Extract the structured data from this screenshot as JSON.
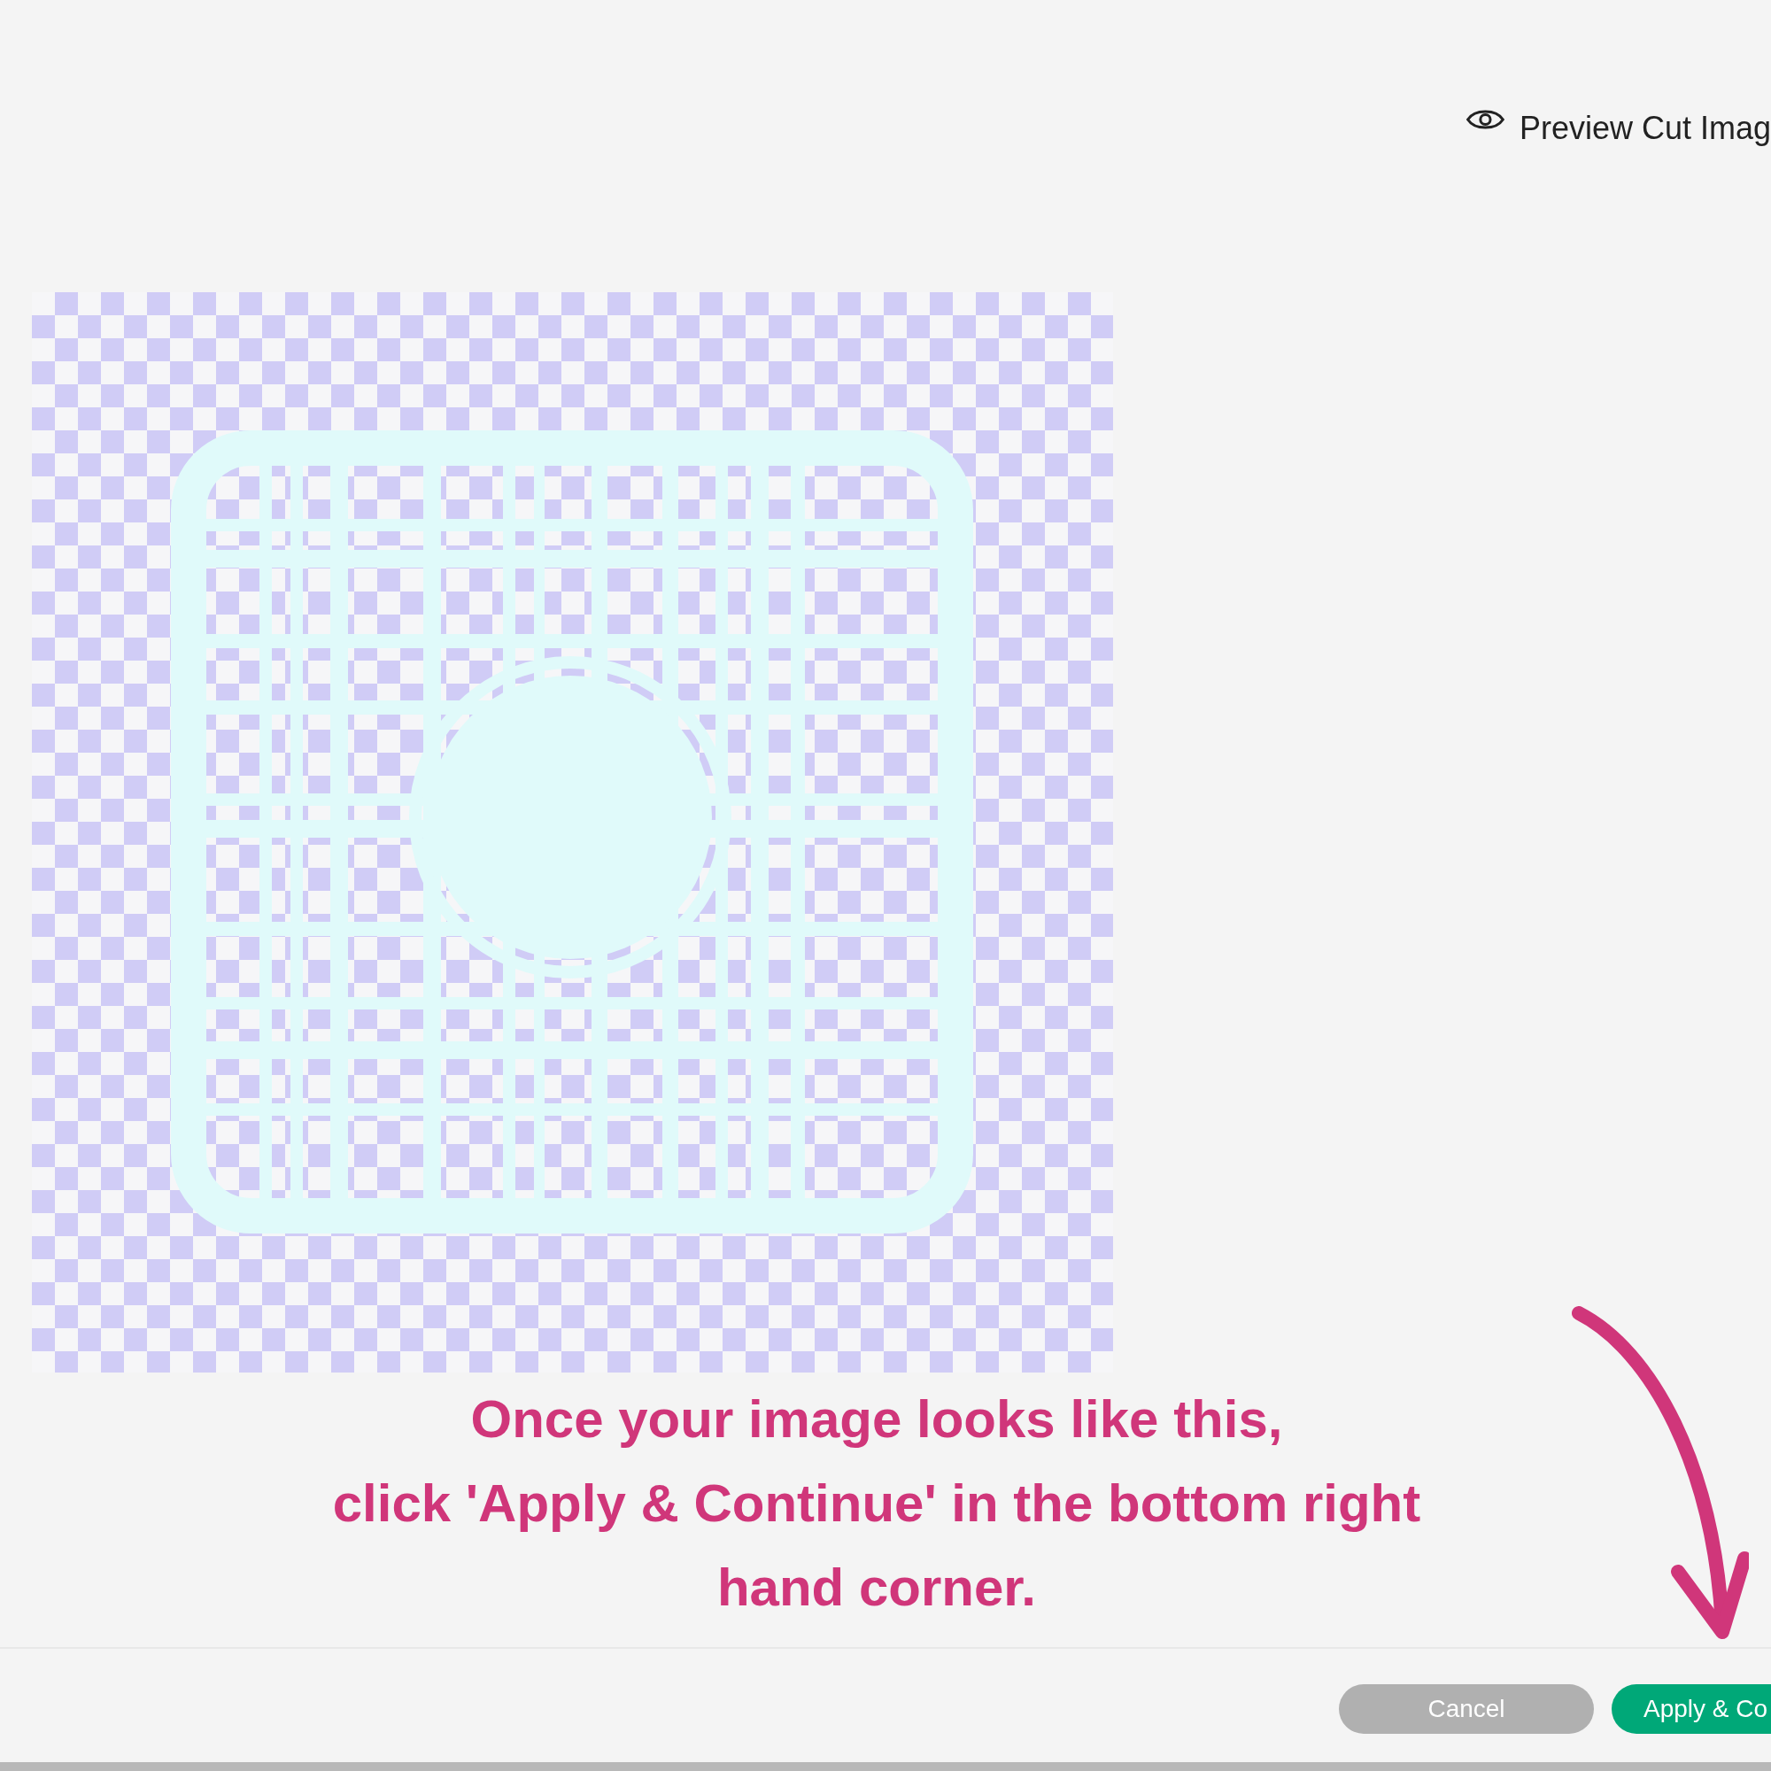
{
  "header": {
    "preview_label": "Preview Cut Imag"
  },
  "annotation": {
    "lines": [
      "Once your image looks like this,",
      "click 'Apply & Continue' in the bottom right",
      "hand corner."
    ]
  },
  "footer": {
    "buttons": [
      {
        "label": "Cancel",
        "kind": "secondary"
      },
      {
        "label": "Apply & Co",
        "kind": "primary"
      }
    ]
  }
}
